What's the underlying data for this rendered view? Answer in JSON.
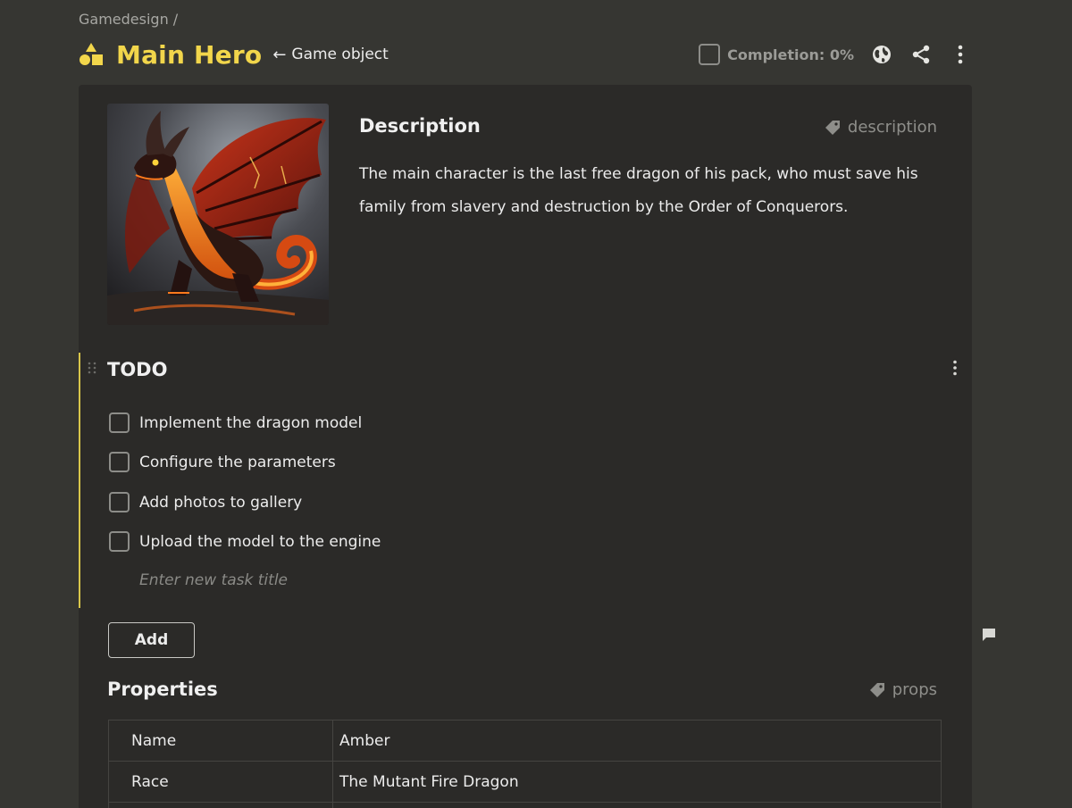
{
  "breadcrumb": "Gamedesign /",
  "header": {
    "title": "Main Hero",
    "back_arrow": "←",
    "back_label": "Game object",
    "completion_label": "Completion: 0%",
    "accent_color": "#f2d64b"
  },
  "description": {
    "title": "Description",
    "tag": "description",
    "text": "The main character is the last free dragon of his pack, who must save his family from slavery and destruction by the Order of Conquerors."
  },
  "todo": {
    "title": "TODO",
    "items": [
      {
        "label": "Implement the dragon model",
        "checked": false
      },
      {
        "label": "Configure the parameters",
        "checked": false
      },
      {
        "label": "Add photos to gallery",
        "checked": false
      },
      {
        "label": "Upload the model to the engine",
        "checked": false
      }
    ],
    "new_task_placeholder": "Enter new task title",
    "add_label": "Add"
  },
  "properties": {
    "title": "Properties",
    "tag": "props",
    "rows": [
      {
        "name": "Name",
        "value": "Amber"
      },
      {
        "name": "Race",
        "value": "The Mutant Fire Dragon"
      },
      {
        "name": "",
        "value": ""
      }
    ]
  }
}
